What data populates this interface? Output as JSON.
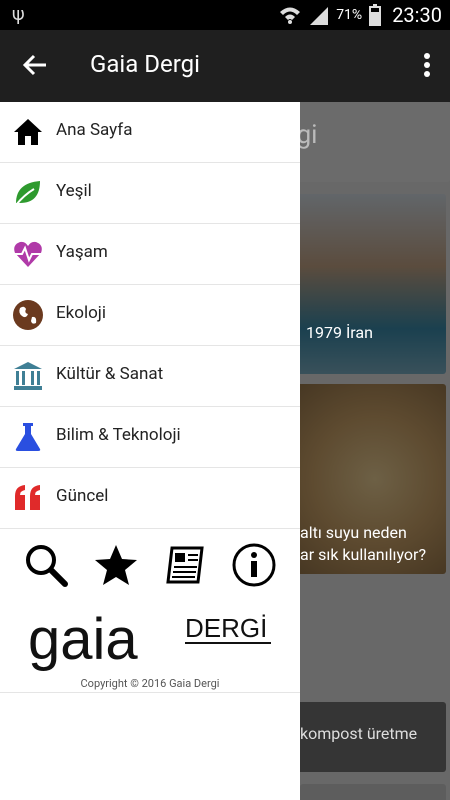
{
  "status_bar": {
    "battery": "71%",
    "time": "23:30"
  },
  "app_bar": {
    "title": "Gaia Dergi"
  },
  "drawer": {
    "items": [
      {
        "label": "Ana Sayfa",
        "icon": "home-icon",
        "color": "#000000"
      },
      {
        "label": "Yeşil",
        "icon": "leaf-icon",
        "color": "#2e9a2e"
      },
      {
        "label": "Yaşam",
        "icon": "heart-pulse-icon",
        "color": "#b03aa8"
      },
      {
        "label": "Ekoloji",
        "icon": "globe-icon",
        "color": "#6b3a1f"
      },
      {
        "label": "Kültür & Sanat",
        "icon": "museum-icon",
        "color": "#3f7f95"
      },
      {
        "label": "Bilim & Teknoloji",
        "icon": "flask-icon",
        "color": "#2a4fe0"
      },
      {
        "label": "Güncel",
        "icon": "quote-icon",
        "color": "#e02a2a"
      }
    ],
    "icon_bar": [
      "search-icon",
      "star-icon",
      "newspaper-icon",
      "info-icon"
    ],
    "logo": {
      "primary": "gaia",
      "secondary": "DERGİ"
    },
    "copyright": "Copyright © 2016 Gaia Dergi"
  },
  "background": {
    "section_title": "rgi",
    "card1_caption": "1979 İran",
    "card2_caption_line1": "altı suyu neden",
    "card2_caption_line2": "ar sık kullanılıyor?",
    "card3_caption": "kompost üretme"
  }
}
